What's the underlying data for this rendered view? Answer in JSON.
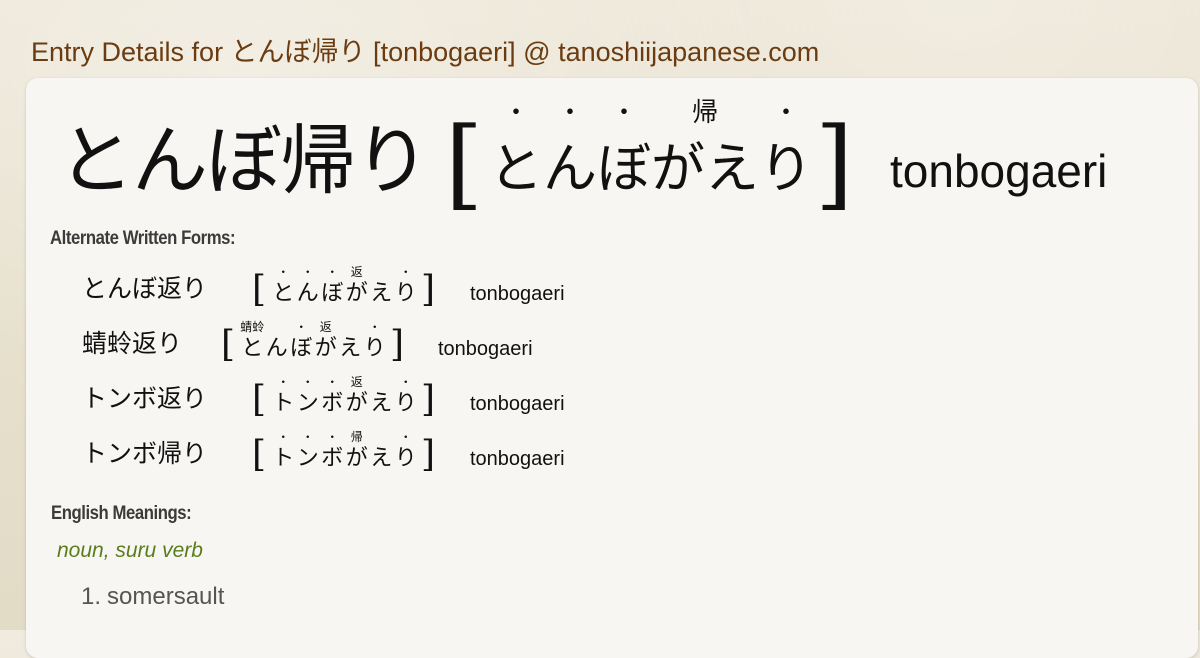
{
  "header": {
    "title": "Entry Details for とんぼ帰り [tonbogaeri] @ tanoshiijapanese.com"
  },
  "entry": {
    "kanji": "とんぼ帰り",
    "bracket_open": "[",
    "bracket_close": "]",
    "kana": [
      {
        "char": "と",
        "ruby": "・"
      },
      {
        "char": "ん",
        "ruby": "・"
      },
      {
        "char": "ぼ",
        "ruby": "・"
      },
      {
        "char": "が",
        "ruby": "帰"
      },
      {
        "char": "え",
        "ruby": ""
      },
      {
        "char": "り",
        "ruby": "・"
      }
    ],
    "romaji": "tonbogaeri"
  },
  "alternate": {
    "label": "Alternate Written Forms:",
    "forms": [
      {
        "kanji": "とんぼ返り",
        "kana": [
          {
            "char": "と",
            "ruby": "・"
          },
          {
            "char": "ん",
            "ruby": "・"
          },
          {
            "char": "ぼ",
            "ruby": "・"
          },
          {
            "char": "が",
            "ruby": "返"
          },
          {
            "char": "え",
            "ruby": ""
          },
          {
            "char": "り",
            "ruby": "・"
          }
        ],
        "romaji": "tonbogaeri"
      },
      {
        "kanji": "蜻蛉返り",
        "kana": [
          {
            "char": "と",
            "ruby": "蜻蛉"
          },
          {
            "char": "ん",
            "ruby": ""
          },
          {
            "char": "ぼ",
            "ruby": "・"
          },
          {
            "char": "が",
            "ruby": "返"
          },
          {
            "char": "え",
            "ruby": ""
          },
          {
            "char": "り",
            "ruby": "・"
          }
        ],
        "romaji": "tonbogaeri"
      },
      {
        "kanji": "トンボ返り",
        "kana": [
          {
            "char": "ト",
            "ruby": "・"
          },
          {
            "char": "ン",
            "ruby": "・"
          },
          {
            "char": "ボ",
            "ruby": "・"
          },
          {
            "char": "が",
            "ruby": "返"
          },
          {
            "char": "え",
            "ruby": ""
          },
          {
            "char": "り",
            "ruby": "・"
          }
        ],
        "romaji": "tonbogaeri"
      },
      {
        "kanji": "トンボ帰り",
        "kana": [
          {
            "char": "ト",
            "ruby": "・"
          },
          {
            "char": "ン",
            "ruby": "・"
          },
          {
            "char": "ボ",
            "ruby": "・"
          },
          {
            "char": "が",
            "ruby": "帰"
          },
          {
            "char": "え",
            "ruby": ""
          },
          {
            "char": "り",
            "ruby": "・"
          }
        ],
        "romaji": "tonbogaeri"
      }
    ]
  },
  "meanings": {
    "label": "English Meanings:",
    "part_of_speech": "noun, suru verb",
    "items": [
      {
        "num": "1.",
        "text": "somersault"
      }
    ]
  },
  "colors": {
    "title": "#6b3c12",
    "part_of_speech": "#5a7d1c",
    "meaning_text": "#555555",
    "card_bg": "#f7f6f2"
  }
}
